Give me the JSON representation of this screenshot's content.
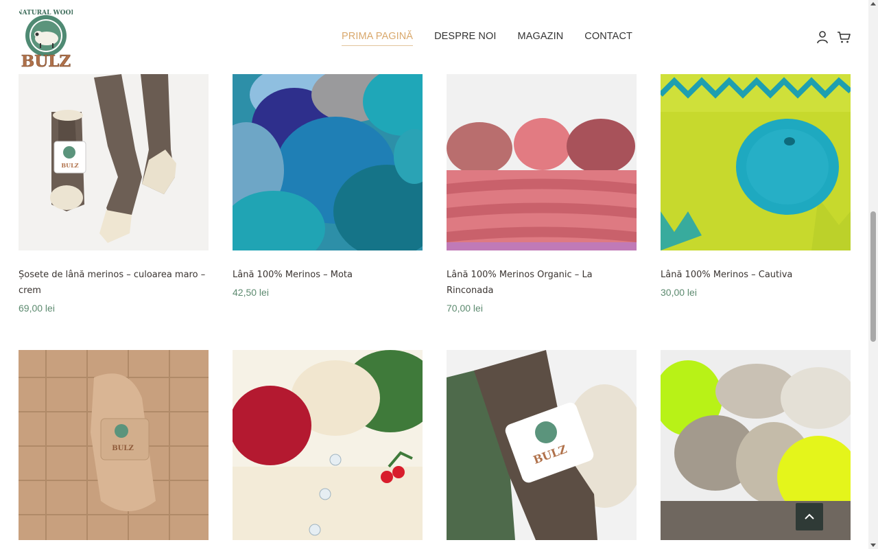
{
  "brand": {
    "top_text": "NATURAL WOOL",
    "name": "BULZ"
  },
  "nav": {
    "items": [
      {
        "label": "PRIMA PAGINĂ",
        "active": true
      },
      {
        "label": "DESPRE NOI",
        "active": false
      },
      {
        "label": "MAGAZIN",
        "active": false
      },
      {
        "label": "CONTACT",
        "active": false
      }
    ]
  },
  "header_icons": [
    "user-icon",
    "cart-icon"
  ],
  "products": [
    {
      "title": "Șosete de lână merinos – culoarea maro – crem",
      "price": "69,00 lei"
    },
    {
      "title": "Lână 100% Merinos – Mota",
      "price": "42,50 lei"
    },
    {
      "title": "Lână 100% Merinos Organic – La Rinconada",
      "price": "70,00 lei"
    },
    {
      "title": "Lână 100% Merinos – Cautiva",
      "price": "30,00 lei"
    },
    {
      "title": "",
      "price": ""
    },
    {
      "title": "",
      "price": ""
    },
    {
      "title": "",
      "price": ""
    },
    {
      "title": "",
      "price": ""
    }
  ],
  "colors": {
    "accent": "#d9a86c",
    "price": "#5c8a6f",
    "logo_green": "#4b7f6a",
    "logo_brown": "#b0714a"
  }
}
